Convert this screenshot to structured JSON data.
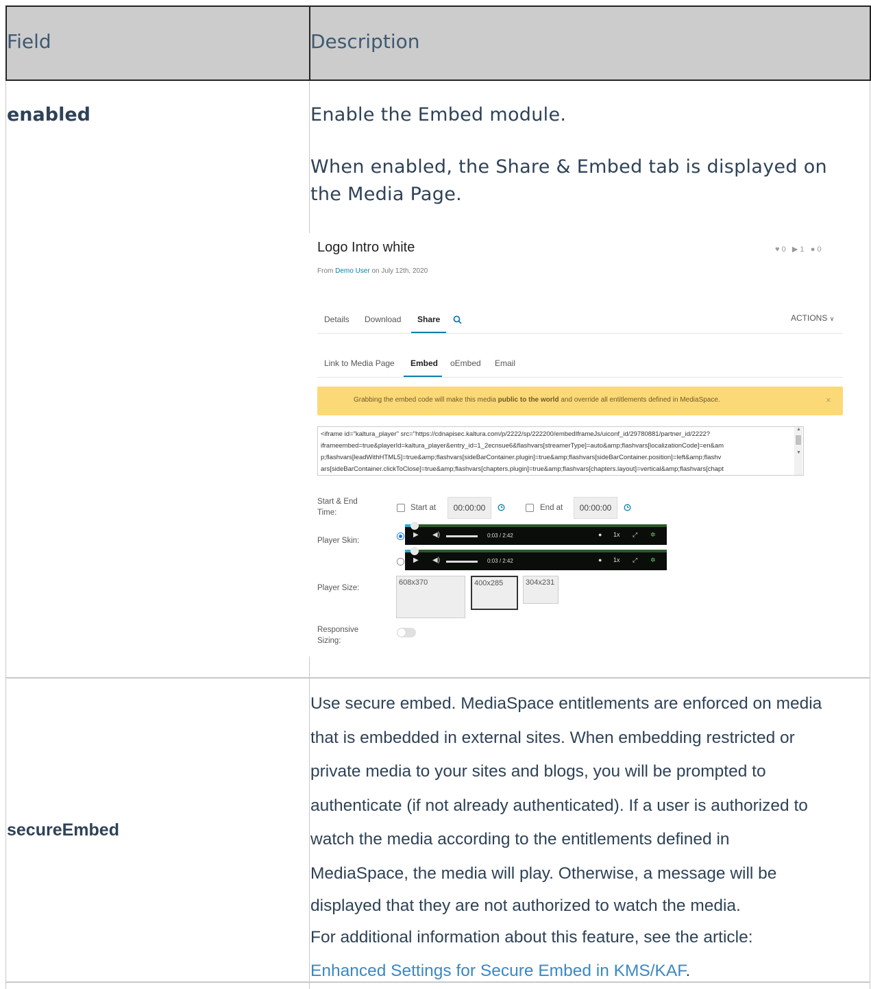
{
  "table": {
    "header": {
      "field": "Field",
      "description": "Description"
    },
    "rows": [
      {
        "field": "enabled",
        "description_lines": [
          "Enable the Embed module.",
          "When enabled, the Share & Embed tab is displayed on",
          "the Media Page."
        ]
      },
      {
        "field": "secureEmbed",
        "description_lines": [
          "Use secure embed. MediaSpace entitlements are enforced on media",
          "that is embedded in external sites. When embedding restricted or",
          "private media to your sites and blogs, you will be prompted to",
          "authenticate (if not already authenticated). If a user is authorized to",
          "watch the media according to the entitlements defined in",
          "MediaSpace, the media will play. Otherwise, a message will be",
          "displayed that they are not authorized to watch the media.",
          "For additional information about this feature, see the article:"
        ],
        "link_text": "Enhanced Settings for Secure Embed in KMS/KAF",
        "link_suffix": "."
      }
    ]
  },
  "screenshot": {
    "media_title": "Logo Intro white",
    "stats": {
      "likes": "0",
      "plays": "1",
      "comments": "0"
    },
    "from_prefix": "From ",
    "author": "Demo User",
    "date_suffix": " on July 12th, 2020",
    "tabs": [
      "Details",
      "Download",
      "Share"
    ],
    "actions_label": "ACTIONS",
    "subtabs": [
      "Link to Media Page",
      "Embed",
      "oEmbed",
      "Email"
    ],
    "banner": {
      "before": "Grabbing the embed code will make this media ",
      "bold": "public to the world",
      "after": " and override all entitlements defined in MediaSpace.",
      "close": "×"
    },
    "embed_code_lines": [
      "<iframe id=\"kaltura_player\" src=\"https://cdnapisec.kaltura.com/p/2222/sp/222200/embedIframeJs/uiconf_id/29780881/partner_id/2222?",
      "iframeembed=true&playerId=kaltura_player&entry_id=1_2ecnsue6&flashvars[streamerType]=auto&amp;flashvars[localizationCode]=en&am",
      "p;flashvars[leadWithHTML5]=true&amp;flashvars[sideBarContainer.plugin]=true&amp;flashvars[sideBarContainer.position]=left&amp;flashv",
      "ars[sideBarContainer.clickToClose]=true&amp;flashvars[chapters.plugin]=true&amp;flashvars[chapters.layout]=vertical&amp;flashvars[chapt"
    ],
    "start_end_label_1": "Start & End",
    "start_end_label_2": "Time:",
    "start_at_label": "Start at",
    "start_time": "00:00:00",
    "end_at_label": "End at",
    "end_time": "00:00:00",
    "player_skin_label": "Player Skin:",
    "player_time": "0:03",
    "player_duration": "/ 2:42",
    "player_speed": "1x",
    "player_size_label": "Player Size:",
    "sizes": [
      "608x370",
      "400x285",
      "304x231"
    ],
    "responsive_label_1": "Responsive",
    "responsive_label_2": "Sizing:"
  }
}
